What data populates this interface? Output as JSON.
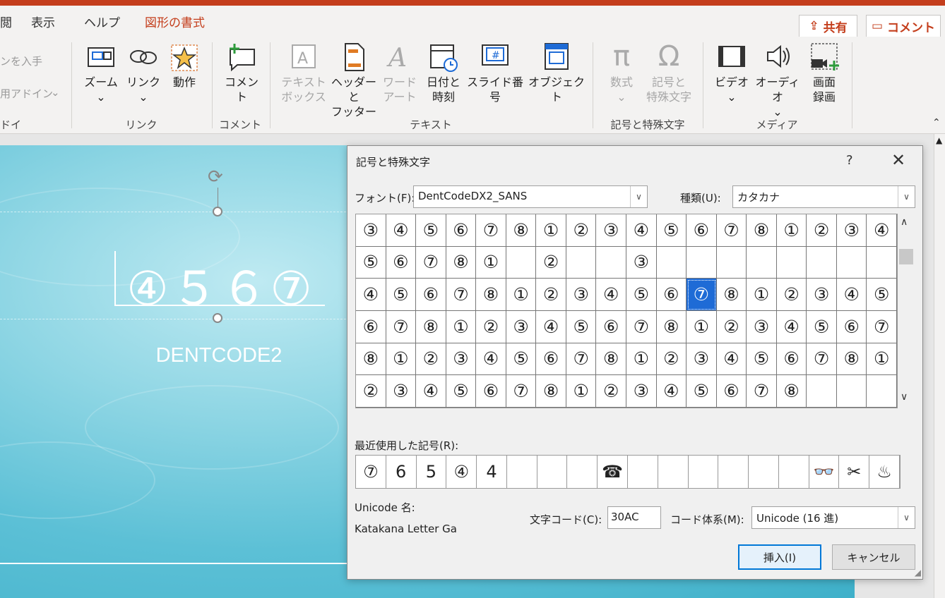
{
  "ribbon_tabs": [
    "閲",
    "表示",
    "ヘルプ",
    "図形の書式"
  ],
  "share_label": "共有",
  "comment_btn_label": "コメント",
  "addins": {
    "item1": "ンを入手",
    "item2": "用アドイン",
    "group": "ドイン"
  },
  "link_group": {
    "zoom": "ズーム",
    "link": "リンク",
    "action": "動作",
    "label": "リンク"
  },
  "comment_group": {
    "button": "コメント",
    "label": "コメント"
  },
  "text_group": {
    "textbox": "テキスト\nボックス",
    "header_footer": "ヘッダーと\nフッター",
    "wordart": "ワード\nアート",
    "datetime": "日付と\n時刻",
    "slide_number": "スライド番号",
    "object": "オブジェクト",
    "label": "テキスト"
  },
  "symbols_group": {
    "equation": "数式",
    "symbol": "記号と\n特殊文字",
    "label": "記号と特殊文字"
  },
  "media_group": {
    "video": "ビデオ",
    "audio": "オーディオ",
    "screen_record": "画面\n録画",
    "label": "メディア"
  },
  "slide": {
    "main_text": "④５６⑦",
    "subtitle": "DENTCODE2"
  },
  "dialog": {
    "title": "記号と特殊文字",
    "help": "?",
    "close": "✕",
    "font_label": "フォント(F):",
    "font_value": "DentCodeDX2_SANS",
    "subset_label": "種類(U):",
    "subset_value": "カタカナ",
    "grid": [
      [
        "③",
        "④",
        "⑤",
        "⑥",
        "⑦",
        "⑧",
        "①",
        "②",
        "③",
        "④",
        "⑤",
        "⑥",
        "⑦",
        "⑧",
        "①",
        "②",
        "③",
        "④"
      ],
      [
        "⑤",
        "⑥",
        "⑦",
        "⑧",
        "①",
        "",
        "②",
        "",
        "",
        "③",
        "",
        "",
        "",
        "",
        "",
        "",
        "",
        ""
      ],
      [
        "④",
        "⑤",
        "⑥",
        "⑦",
        "⑧",
        "①",
        "②",
        "③",
        "④",
        "⑤",
        "⑥",
        "⑦",
        "⑧",
        "①",
        "②",
        "③",
        "④",
        "⑤"
      ],
      [
        "⑥",
        "⑦",
        "⑧",
        "①",
        "②",
        "③",
        "④",
        "⑤",
        "⑥",
        "⑦",
        "⑧",
        "①",
        "②",
        "③",
        "④",
        "⑤",
        "⑥",
        "⑦"
      ],
      [
        "⑧",
        "①",
        "②",
        "③",
        "④",
        "⑤",
        "⑥",
        "⑦",
        "⑧",
        "①",
        "②",
        "③",
        "④",
        "⑤",
        "⑥",
        "⑦",
        "⑧",
        "①"
      ],
      [
        "②",
        "③",
        "④",
        "⑤",
        "⑥",
        "⑦",
        "⑧",
        "①",
        "②",
        "③",
        "④",
        "⑤",
        "⑥",
        "⑦",
        "⑧",
        "",
        "",
        ""
      ]
    ],
    "selected": "2-11",
    "recent_label": "最近使用した記号(R):",
    "recent": [
      "⑦",
      "6",
      "5",
      "④",
      "4",
      "",
      "",
      "",
      "☎",
      "",
      "",
      "",
      "",
      "",
      "",
      "👓",
      "✂",
      "♨"
    ],
    "unicode_name_label": "Unicode 名:",
    "unicode_name": "Katakana Letter Ga",
    "char_code_label": "文字コード(C):",
    "char_code": "30AC",
    "from_label": "コード体系(M):",
    "from_value": "Unicode (16 進)",
    "insert": "挿入(I)",
    "cancel": "キャンセル"
  }
}
